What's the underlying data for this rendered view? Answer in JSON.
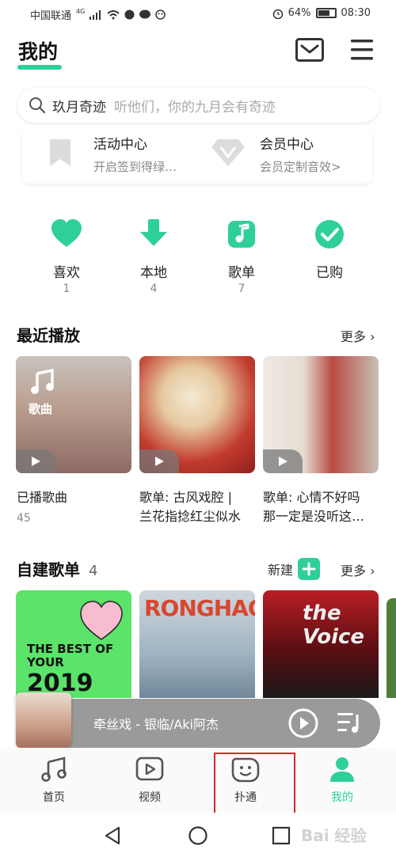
{
  "status_bar": {
    "carrier": "中国联通",
    "network": "4G",
    "battery": "64%",
    "time": "08:30"
  },
  "header": {
    "title": "我的"
  },
  "search": {
    "query": "玖月奇迹",
    "hint": "听他们，你的九月会有奇迹"
  },
  "cards": [
    {
      "title": "活动中心",
      "subtitle": "开启签到得绿…"
    },
    {
      "title": "会员中心",
      "subtitle": "会员定制音效>"
    }
  ],
  "quick_actions": [
    {
      "label": "喜欢",
      "count": "1",
      "icon": "heart-icon"
    },
    {
      "label": "本地",
      "count": "4",
      "icon": "download-icon"
    },
    {
      "label": "歌单",
      "count": "7",
      "icon": "music-note-icon"
    },
    {
      "label": "已购",
      "count": "",
      "icon": "check-icon"
    }
  ],
  "recent": {
    "title": "最近播放",
    "more": "更多",
    "items": [
      {
        "overlay": "歌曲",
        "caption_line1": "已播歌曲",
        "caption_line2": "",
        "sub": "45"
      },
      {
        "overlay": "",
        "caption_line1": "歌单: 古风戏腔 |",
        "caption_line2": "兰花指捻红尘似水",
        "sub": ""
      },
      {
        "overlay": "",
        "caption_line1": "歌单: 心情不好吗",
        "caption_line2": "那一定是没听这…",
        "sub": ""
      }
    ]
  },
  "custom": {
    "title": "自建歌单",
    "count": "4",
    "new_label": "新建",
    "more": "更多",
    "tile1_text": "THE BEST OF YOUR",
    "tile1_year": "2019",
    "tile2_text": "RONGHAO",
    "tile3_text": "the Voice"
  },
  "player": {
    "song": "牵丝戏 - 银临/Aki阿杰"
  },
  "tabs": [
    {
      "label": "首页",
      "icon": "music-note-icon"
    },
    {
      "label": "视频",
      "icon": "video-icon"
    },
    {
      "label": "扑通",
      "icon": "smile-icon"
    },
    {
      "label": "我的",
      "icon": "user-icon"
    }
  ],
  "watermark": "Bai 经验",
  "colors": {
    "accent": "#2ecf9b",
    "highlight": "#d62a2a"
  }
}
